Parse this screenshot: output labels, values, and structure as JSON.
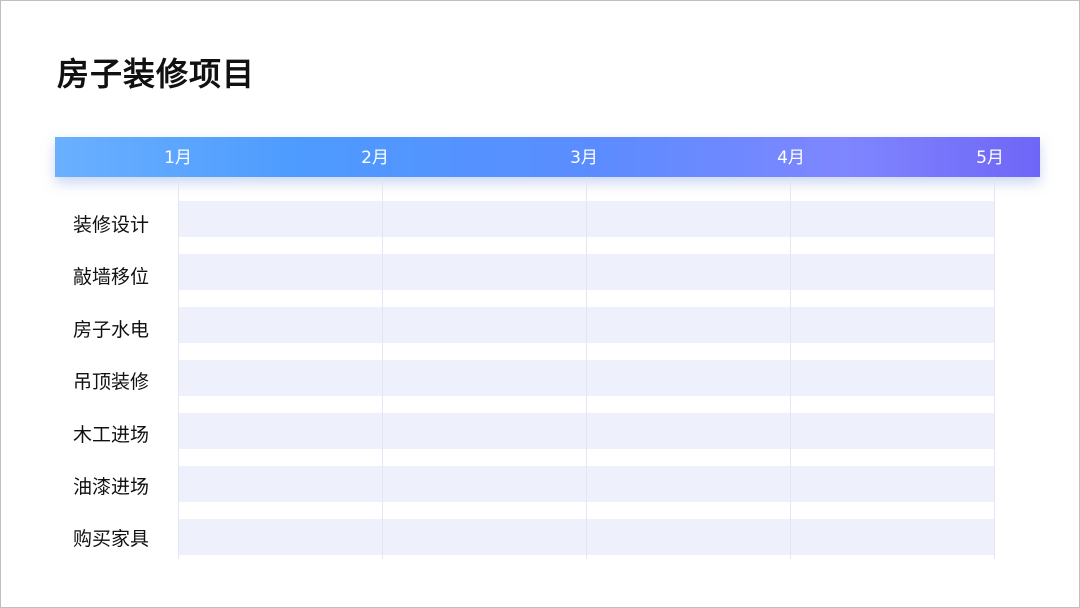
{
  "title": "房子装修项目",
  "months": [
    "1月",
    "2月",
    "3月",
    "4月",
    "5月"
  ],
  "tasks": [
    "装修设计",
    "敲墙移位",
    "房子水电",
    "吊顶装修",
    "木工进场",
    "油漆进场",
    "购买家具"
  ],
  "colors": {
    "gradient_start": "#6ab0ff",
    "gradient_end": "#6f66f7",
    "row_band": "#eef0fc",
    "grid_line": "#e3e6f3"
  }
}
